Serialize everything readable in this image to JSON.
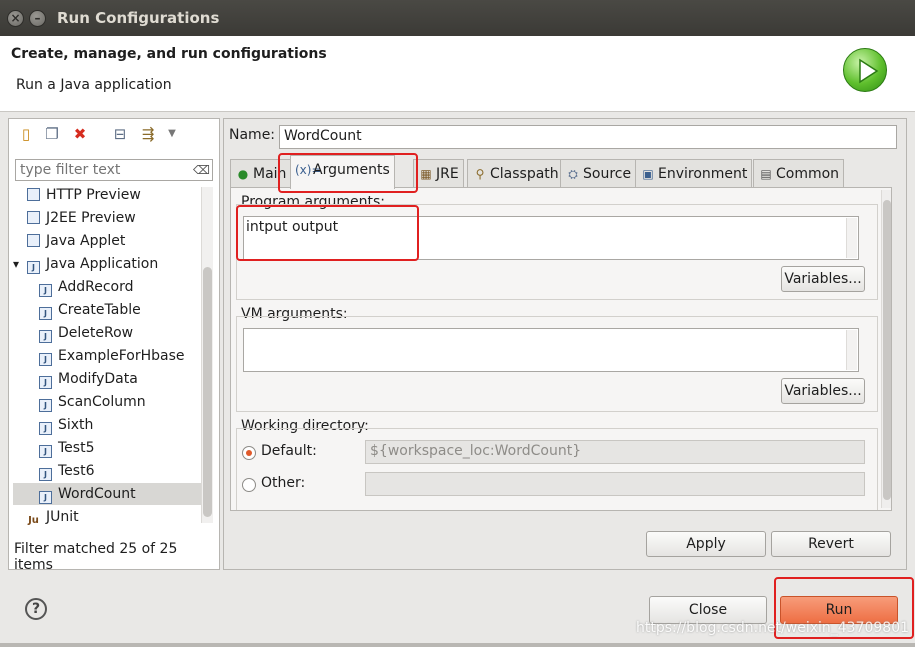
{
  "window": {
    "title": "Run Configurations",
    "close_glyph": "×",
    "minimize_glyph": "–"
  },
  "header": {
    "title": "Create, manage, and run configurations",
    "subtitle": "Run a Java application",
    "logo_icon": "run-play-icon"
  },
  "left": {
    "toolbar_icons": [
      "new-configuration-icon",
      "duplicate-icon",
      "delete-icon",
      "collapse-all-icon",
      "filter-icon",
      "dropdown-icon"
    ],
    "filter_placeholder": "type filter text",
    "filter_clear_glyph": "⌫",
    "tree": [
      {
        "label": "HTTP Preview",
        "level": 1,
        "icon": "config-icon"
      },
      {
        "label": "J2EE Preview",
        "level": 1,
        "icon": "config-icon"
      },
      {
        "label": "Java Applet",
        "level": 1,
        "icon": "applet-icon"
      },
      {
        "label": "Java Application",
        "level": 1,
        "icon": "java-app-icon",
        "expanded": true
      },
      {
        "label": "AddRecord",
        "level": 2,
        "icon": "java-file-icon"
      },
      {
        "label": "CreateTable",
        "level": 2,
        "icon": "java-file-icon"
      },
      {
        "label": "DeleteRow",
        "level": 2,
        "icon": "java-file-icon"
      },
      {
        "label": "ExampleForHbase",
        "level": 2,
        "icon": "java-file-icon"
      },
      {
        "label": "ModifyData",
        "level": 2,
        "icon": "java-file-icon"
      },
      {
        "label": "ScanColumn",
        "level": 2,
        "icon": "java-file-icon"
      },
      {
        "label": "Sixth",
        "level": 2,
        "icon": "java-file-icon"
      },
      {
        "label": "Test5",
        "level": 2,
        "icon": "java-file-icon"
      },
      {
        "label": "Test6",
        "level": 2,
        "icon": "java-file-icon"
      },
      {
        "label": "WordCount",
        "level": 2,
        "icon": "java-file-icon",
        "selected": true
      },
      {
        "label": "JUnit",
        "level": 1,
        "icon": "junit-icon"
      }
    ],
    "filter_status": "Filter matched 25 of 25 items"
  },
  "right": {
    "name_label": "Name:",
    "name_value": "WordCount",
    "tabs": [
      {
        "label": "Main",
        "icon": "main-tab-icon"
      },
      {
        "label": "Arguments",
        "icon": "arguments-tab-icon",
        "active": true
      },
      {
        "label": "JRE",
        "icon": "jre-tab-icon"
      },
      {
        "label": "Classpath",
        "icon": "classpath-tab-icon"
      },
      {
        "label": "Source",
        "icon": "source-tab-icon"
      },
      {
        "label": "Environment",
        "icon": "environment-tab-icon"
      },
      {
        "label": "Common",
        "icon": "common-tab-icon"
      }
    ],
    "program_args_label": "Program arguments:",
    "program_args_value": "intput output",
    "variables_label": "Variables...",
    "vm_args_label": "VM arguments:",
    "vm_args_value": "",
    "working_dir_label": "Working directory:",
    "default_label": "Default:",
    "default_value": "${workspace_loc:WordCount}",
    "other_label": "Other:",
    "other_value": "",
    "apply_label": "Apply",
    "revert_label": "Revert"
  },
  "footer": {
    "close_label": "Close",
    "run_label": "Run",
    "watermark": "https://blog.csdn.net/weixin_43709801"
  },
  "colors": {
    "highlight": "#e02020",
    "run_button": "#ee6e43",
    "selected_row": "#d8d7d4"
  }
}
